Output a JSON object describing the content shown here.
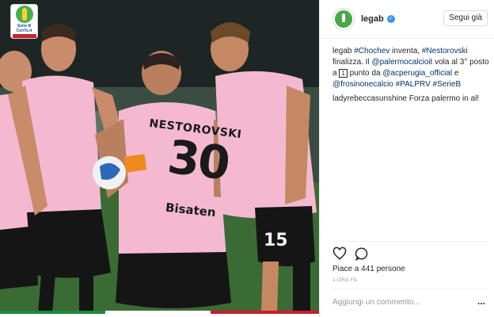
{
  "photo": {
    "league_badge_text": "Serie B ConTe.it",
    "jersey_name": "NESTOROVSKI",
    "jersey_number": "30",
    "jersey_sponsor": "Bisaten",
    "colors": {
      "jersey": "#f2b8cf",
      "shorts": "#141414",
      "pitch": "#3d6b3a"
    }
  },
  "post": {
    "username": "legab",
    "verified_icon": "verified-badge-icon",
    "follow_label": "Segui già",
    "caption": {
      "author": "legab",
      "tokens": [
        {
          "t": "#Chochev",
          "tag": true
        },
        {
          "t": " inventa, ",
          "tag": false
        },
        {
          "t": "#Nestorovski",
          "tag": true
        },
        {
          "t": " finalizza. Il ",
          "tag": false
        },
        {
          "t": "@palermocalcioit",
          "tag": true
        },
        {
          "t": " vola al 3° posto a ",
          "tag": false
        },
        {
          "t": "1",
          "tag": false,
          "boxed": true
        },
        {
          "t": " punto da ",
          "tag": false
        },
        {
          "t": "@acperugia_official",
          "tag": true
        },
        {
          "t": " e ",
          "tag": false
        },
        {
          "t": "@frosinonecalcio",
          "tag": true
        },
        {
          "t": " ",
          "tag": false
        },
        {
          "t": "#PALPRV",
          "tag": true
        },
        {
          "t": " ",
          "tag": false
        },
        {
          "t": "#SerieB",
          "tag": true
        }
      ]
    },
    "comment": {
      "author": "ladyrebeccasunshine",
      "text": "Forza palermo in al!"
    },
    "actions": {
      "like_icon": "heart-icon",
      "comment_icon": "comment-bubble-icon"
    },
    "likes_label": "Piace a 441 persone",
    "time_label": "1 ORA FA",
    "comment_placeholder": "Aggiungi un commento...",
    "more_label": "..."
  }
}
